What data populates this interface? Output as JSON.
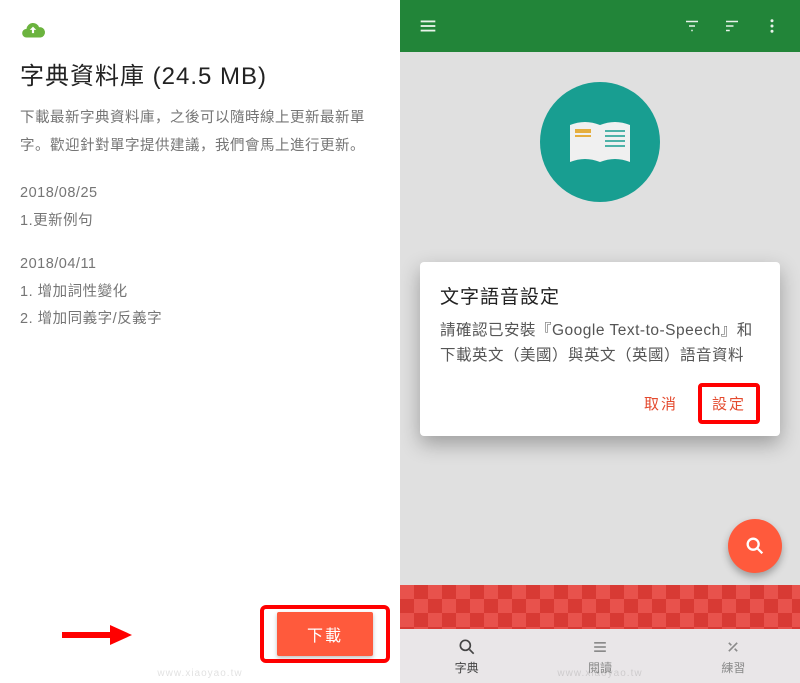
{
  "left": {
    "title": "字典資料庫 (24.5 MB)",
    "description": "下載最新字典資料庫，之後可以隨時線上更新最新單字。歡迎針對單字提供建議，我們會馬上進行更新。",
    "changelog": [
      {
        "date": "2018/08/25",
        "items": [
          "1.更新例句"
        ]
      },
      {
        "date": "2018/04/11",
        "items": [
          "1. 增加詞性變化",
          "2. 增加同義字/反義字"
        ]
      }
    ],
    "download_label": "下載"
  },
  "right": {
    "hero_icon": "book-icon",
    "dialog": {
      "title": "文字語音設定",
      "message": "請確認已安裝『Google Text-to-Speech』和下載英文（美國）與英文（英國）語音資料",
      "cancel": "取消",
      "confirm": "設定"
    },
    "fab_icon": "search-icon",
    "bottom_nav": [
      {
        "icon": "search-icon",
        "label": "字典"
      },
      {
        "icon": "list-icon",
        "label": "閱讀"
      },
      {
        "icon": "tools-icon",
        "label": "練習"
      }
    ]
  },
  "colors": {
    "accent_green": "#228539",
    "accent_orange": "#ff5a3c",
    "highlight_red": "#ff0000",
    "teal": "#1aa89b"
  }
}
